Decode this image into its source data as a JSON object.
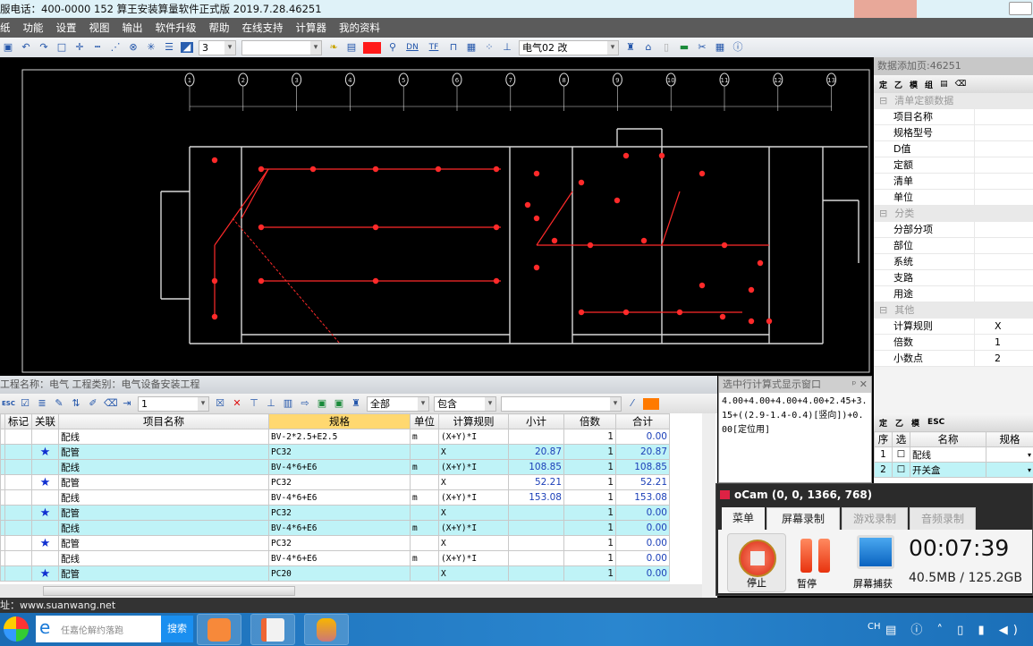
{
  "titlebar": {
    "text": "服电话：400-0000 152   算王安装算量软件正式版 2019.7.28.46251"
  },
  "menu": [
    "纸",
    "功能",
    "设置",
    "视图",
    "输出",
    "软件升级",
    "帮助",
    "在线支持",
    "计算器",
    "我的资料"
  ],
  "toolbar": {
    "layer_value": "3",
    "color_hex": "#ff1a1a",
    "style_value": "电气02 改",
    "labels": [
      "DN",
      "TF"
    ]
  },
  "cad": {
    "axis_labels": [
      "1",
      "2",
      "3",
      "4",
      "5",
      "6",
      "7",
      "8",
      "9",
      "10",
      "11",
      "12",
      "13"
    ],
    "background": "#000000",
    "wire_color": "#ff2a2a"
  },
  "right_panel": {
    "title": "数据添加页:46251",
    "tool_labels": [
      "定",
      "乙",
      "模",
      "组"
    ],
    "groups": [
      {
        "name": "清单定额数据",
        "rows": [
          {
            "k": "项目名称",
            "v": ""
          },
          {
            "k": "规格型号",
            "v": ""
          },
          {
            "k": "D值",
            "v": ""
          },
          {
            "k": "定额",
            "v": ""
          },
          {
            "k": "清单",
            "v": ""
          },
          {
            "k": "单位",
            "v": ""
          }
        ]
      },
      {
        "name": "分类",
        "rows": [
          {
            "k": "分部分项",
            "v": ""
          },
          {
            "k": "部位",
            "v": ""
          },
          {
            "k": "系统",
            "v": ""
          },
          {
            "k": "支路",
            "v": ""
          },
          {
            "k": "用途",
            "v": ""
          }
        ]
      },
      {
        "name": "其他",
        "rows": [
          {
            "k": "计算规则",
            "v": "X"
          },
          {
            "k": "倍数",
            "v": "1"
          },
          {
            "k": "小数点",
            "v": "2"
          }
        ]
      }
    ]
  },
  "sublist": {
    "tool_labels": [
      "定",
      "乙",
      "模",
      "ESC"
    ],
    "headers": [
      "序",
      "选",
      "名称",
      "规格"
    ],
    "rows": [
      {
        "no": "1",
        "name": "配线"
      },
      {
        "no": "2",
        "name": "开关盒"
      }
    ]
  },
  "bottom": {
    "header": "工程名称：电气  工程类别：电气设备安装工程",
    "row_value": "1",
    "filter_scope": "全部",
    "filter_mode": "包含",
    "filter_text": "",
    "columns": [
      "",
      "标记",
      "关联",
      "项目名称",
      "规格",
      "单位",
      "计算规则",
      "小计",
      "倍数",
      "合计"
    ],
    "rows": [
      {
        "linked": false,
        "name": "配线",
        "spec": "BV-2*2.5+E2.5",
        "unit": "m",
        "rule": "(X+Y)*I",
        "sub": "",
        "mult": "1",
        "total": "0.00",
        "hl": false
      },
      {
        "linked": true,
        "name": "配管",
        "spec": "PC32",
        "unit": "",
        "rule": "X",
        "sub": "20.87",
        "mult": "1",
        "total": "20.87",
        "hl": true
      },
      {
        "linked": false,
        "name": "配线",
        "spec": "BV-4*6+E6",
        "unit": "m",
        "rule": "(X+Y)*I",
        "sub": "108.85",
        "mult": "1",
        "total": "108.85",
        "hl": true
      },
      {
        "linked": true,
        "name": "配管",
        "spec": "PC32",
        "unit": "",
        "rule": "X",
        "sub": "52.21",
        "mult": "1",
        "total": "52.21",
        "hl": false
      },
      {
        "linked": false,
        "name": "配线",
        "spec": "BV-4*6+E6",
        "unit": "m",
        "rule": "(X+Y)*I",
        "sub": "153.08",
        "mult": "1",
        "total": "153.08",
        "hl": false
      },
      {
        "linked": true,
        "name": "配管",
        "spec": "PC32",
        "unit": "",
        "rule": "X",
        "sub": "",
        "mult": "1",
        "total": "0.00",
        "hl": true
      },
      {
        "linked": false,
        "name": "配线",
        "spec": "BV-4*6+E6",
        "unit": "m",
        "rule": "(X+Y)*I",
        "sub": "",
        "mult": "1",
        "total": "0.00",
        "hl": true
      },
      {
        "linked": true,
        "name": "配管",
        "spec": "PC32",
        "unit": "",
        "rule": "X",
        "sub": "",
        "mult": "1",
        "total": "0.00",
        "hl": false
      },
      {
        "linked": false,
        "name": "配线",
        "spec": "BV-4*6+E6",
        "unit": "m",
        "rule": "(X+Y)*I",
        "sub": "",
        "mult": "1",
        "total": "0.00",
        "hl": false
      },
      {
        "linked": true,
        "name": "配管",
        "spec": "PC20",
        "unit": "",
        "rule": "X",
        "sub": "",
        "mult": "1",
        "total": "0.00",
        "hl": true
      }
    ]
  },
  "formula": {
    "title": "选中行计算式显示窗口",
    "text": "4.00+4.00+4.00+4.00+2.45+3.15+((2.9-1.4-0.4)[竖向])+0.00[定位用]"
  },
  "ocam": {
    "title": "oCam (0, 0, 1366, 768)",
    "tabs": [
      "菜单",
      "屏幕录制",
      "游戏录制",
      "音频录制"
    ],
    "stop": "停止",
    "pause": "暂停",
    "capture": "屏幕捕获",
    "time": "00:07:39",
    "size": "40.5MB / 125.2GB"
  },
  "status": {
    "text": "址：www.suanwang.net"
  },
  "taskbar": {
    "search_placeholder": "任嘉伦解约落跑",
    "search_button": "搜索",
    "ime": "CH"
  }
}
